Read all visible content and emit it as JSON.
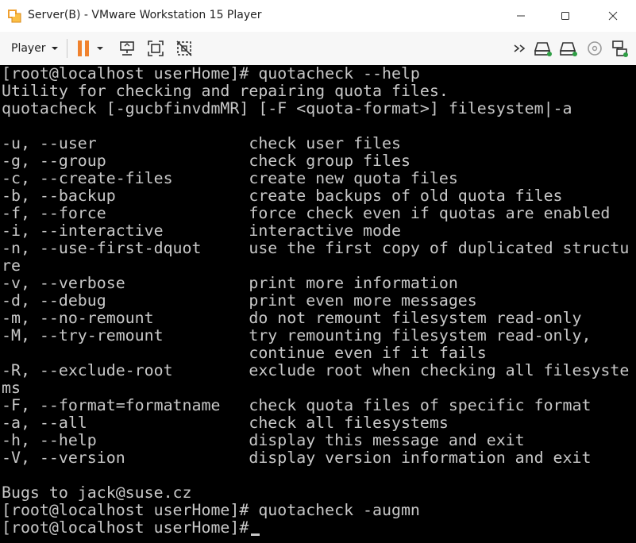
{
  "window": {
    "title": "Server(B) - VMware Workstation 15 Player",
    "icon": "vmware-icon",
    "controls": {
      "minimize": "minimize-icon",
      "maximize": "maximize-icon",
      "close": "close-icon"
    }
  },
  "toolbar": {
    "player_label": "Player",
    "icons": [
      "pause-icon",
      "dropdown-arrow-icon",
      "send-ctrl-alt-del-icon",
      "fit-guest-icon",
      "unity-icon",
      "more-devices-icon",
      "hard-disk-icon",
      "hard-disk-icon",
      "cd-dvd-icon",
      "network-icon"
    ],
    "accent_color": "#f0822e"
  },
  "console": {
    "background": "#000000",
    "foreground": "#c8c8c8",
    "lines": [
      "[root@localhost userHome]# quotacheck --help",
      "Utility for checking and repairing quota files.",
      "quotacheck [-gucbfinvdmMR] [-F <quota-format>] filesystem|-a",
      "",
      "-u, --user                check user files",
      "-g, --group               check group files",
      "-c, --create-files        create new quota files",
      "-b, --backup              create backups of old quota files",
      "-f, --force               force check even if quotas are enabled",
      "-i, --interactive         interactive mode",
      "-n, --use-first-dquot     use the first copy of duplicated structu",
      "re",
      "-v, --verbose             print more information",
      "-d, --debug               print even more messages",
      "-m, --no-remount          do not remount filesystem read-only",
      "-M, --try-remount         try remounting filesystem read-only,",
      "                          continue even if it fails",
      "-R, --exclude-root        exclude root when checking all filesyste",
      "ms",
      "-F, --format=formatname   check quota files of specific format",
      "-a, --all                 check all filesystems",
      "-h, --help                display this message and exit",
      "-V, --version             display version information and exit",
      "",
      "Bugs to jack@suse.cz",
      "[root@localhost userHome]# quotacheck -augmn",
      "[root@localhost userHome]#"
    ]
  }
}
